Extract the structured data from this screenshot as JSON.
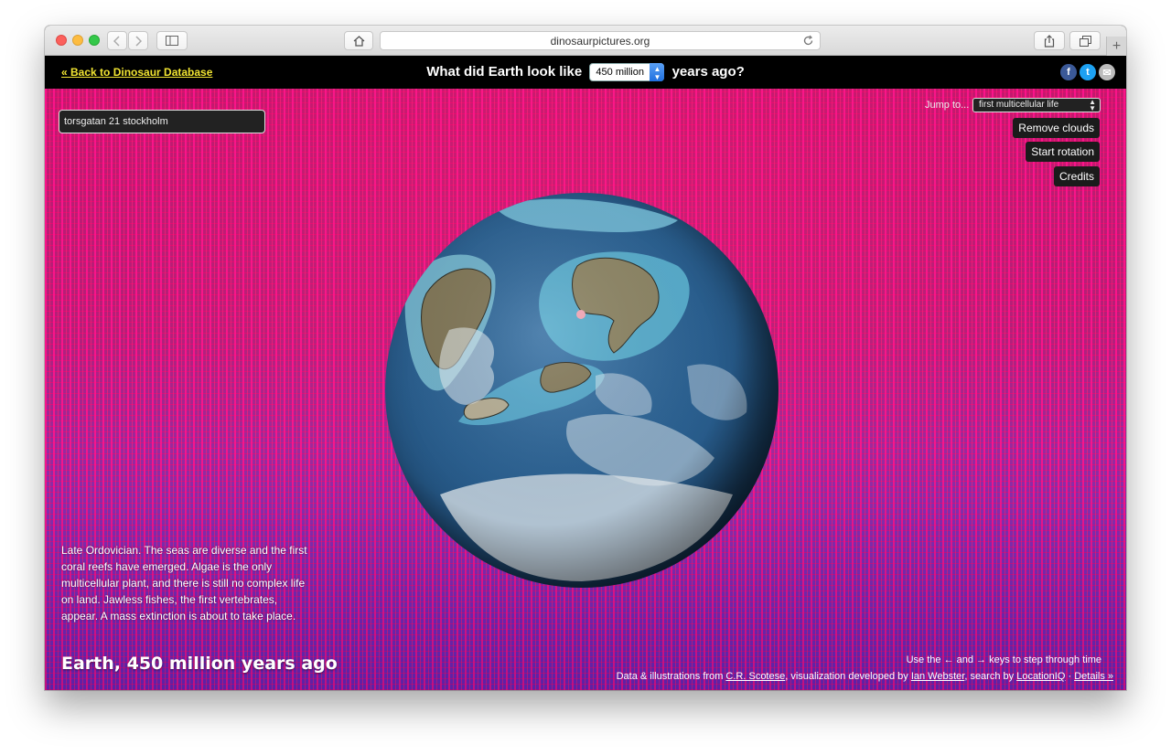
{
  "browser": {
    "url": "dinosaurpictures.org",
    "new_tab_glyph": "+"
  },
  "header": {
    "back_link": "« Back to Dinosaur Database",
    "question_prefix": "What did Earth look like",
    "selected_age": "450 million",
    "question_suffix": "years ago?",
    "share": {
      "facebook": "f",
      "twitter": "t",
      "email": "✉"
    }
  },
  "search": {
    "value": "torsgatan 21 stockholm"
  },
  "controls": {
    "jump_label": "Jump to...",
    "jump_selected": "first multicellular life",
    "remove_clouds": "Remove clouds",
    "start_rotation": "Start rotation",
    "credits": "Credits"
  },
  "description": "Late Ordovician. The seas are diverse and the first coral reefs have emerged. Algae is the only multicellular plant, and there is still no complex life on land. Jawless fishes, the first vertebrates, appear. A mass extinction is about to take place.",
  "era_title": "Earth, 450 million years ago",
  "footer": {
    "key_hint": "Use the ← and → keys to step through time",
    "credit_prefix": "Data & illustrations from",
    "scotese": "C.R. Scotese",
    "credit_mid": ", visualization developed by",
    "webster": "Ian Webster",
    "credit_search": ", search by",
    "locationiq": "LocationIQ",
    "sep": "·",
    "details": "Details »"
  }
}
